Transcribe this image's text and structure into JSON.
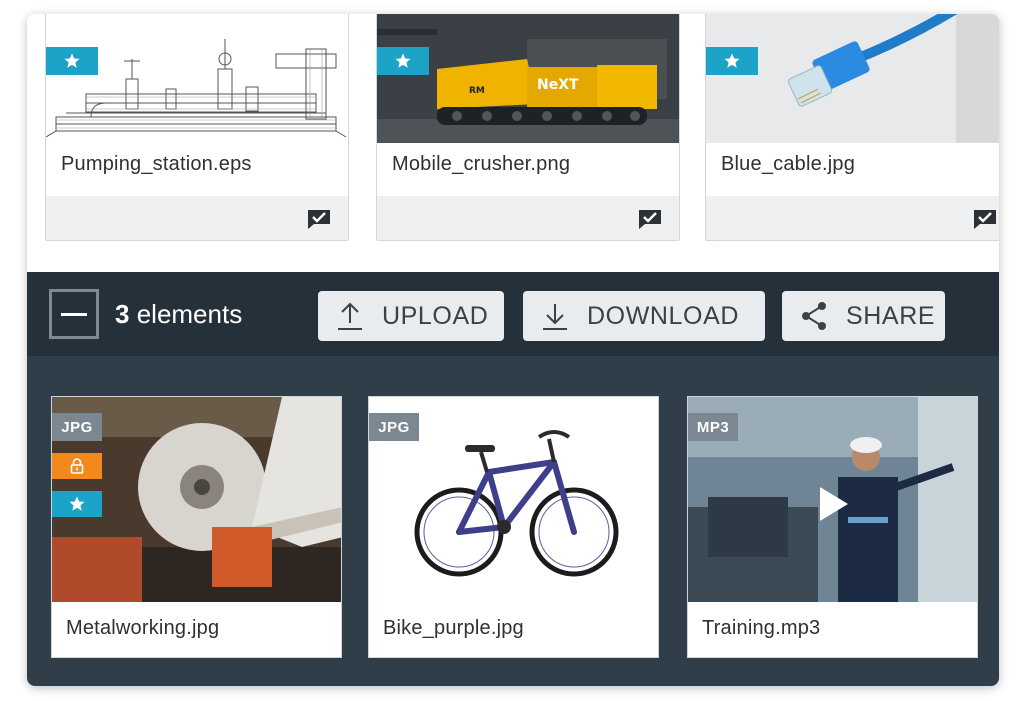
{
  "top_files": [
    {
      "name": "Pumping_station.eps",
      "thumbnail": "pipeline-drawing",
      "starred": true,
      "selected": true
    },
    {
      "name": "Mobile_crusher.png",
      "thumbnail": "mobile-crusher",
      "starred": true,
      "selected": true
    },
    {
      "name": "Blue_cable.jpg",
      "thumbnail": "network-cable",
      "starred": true,
      "selected": true
    }
  ],
  "toolbar": {
    "count_number": "3",
    "count_label": "elements",
    "upload_label": "UPLOAD",
    "download_label": "DOWNLOAD",
    "share_label": "SHARE"
  },
  "files": [
    {
      "name": "Metalworking.jpg",
      "type": "JPG",
      "locked": true,
      "starred": true,
      "thumbnail": "grinding-wheel"
    },
    {
      "name": "Bike_purple.jpg",
      "type": "JPG",
      "locked": false,
      "starred": false,
      "thumbnail": "bicycle"
    },
    {
      "name": "Training.mp3",
      "type": "MP3",
      "locked": false,
      "starred": false,
      "thumbnail": "factory-video"
    }
  ],
  "colors": {
    "accent_blue": "#1ba3c8",
    "lock_orange": "#f2891c",
    "toolbar_bg": "#24313a",
    "bottom_bg": "#2f3e48",
    "type_badge": "#7c8891"
  },
  "icons": {
    "star": "star-icon",
    "check": "check-bubble-icon",
    "lock": "lock-icon",
    "upload": "upload-icon",
    "download": "download-icon",
    "share": "share-icon",
    "play": "play-icon"
  }
}
